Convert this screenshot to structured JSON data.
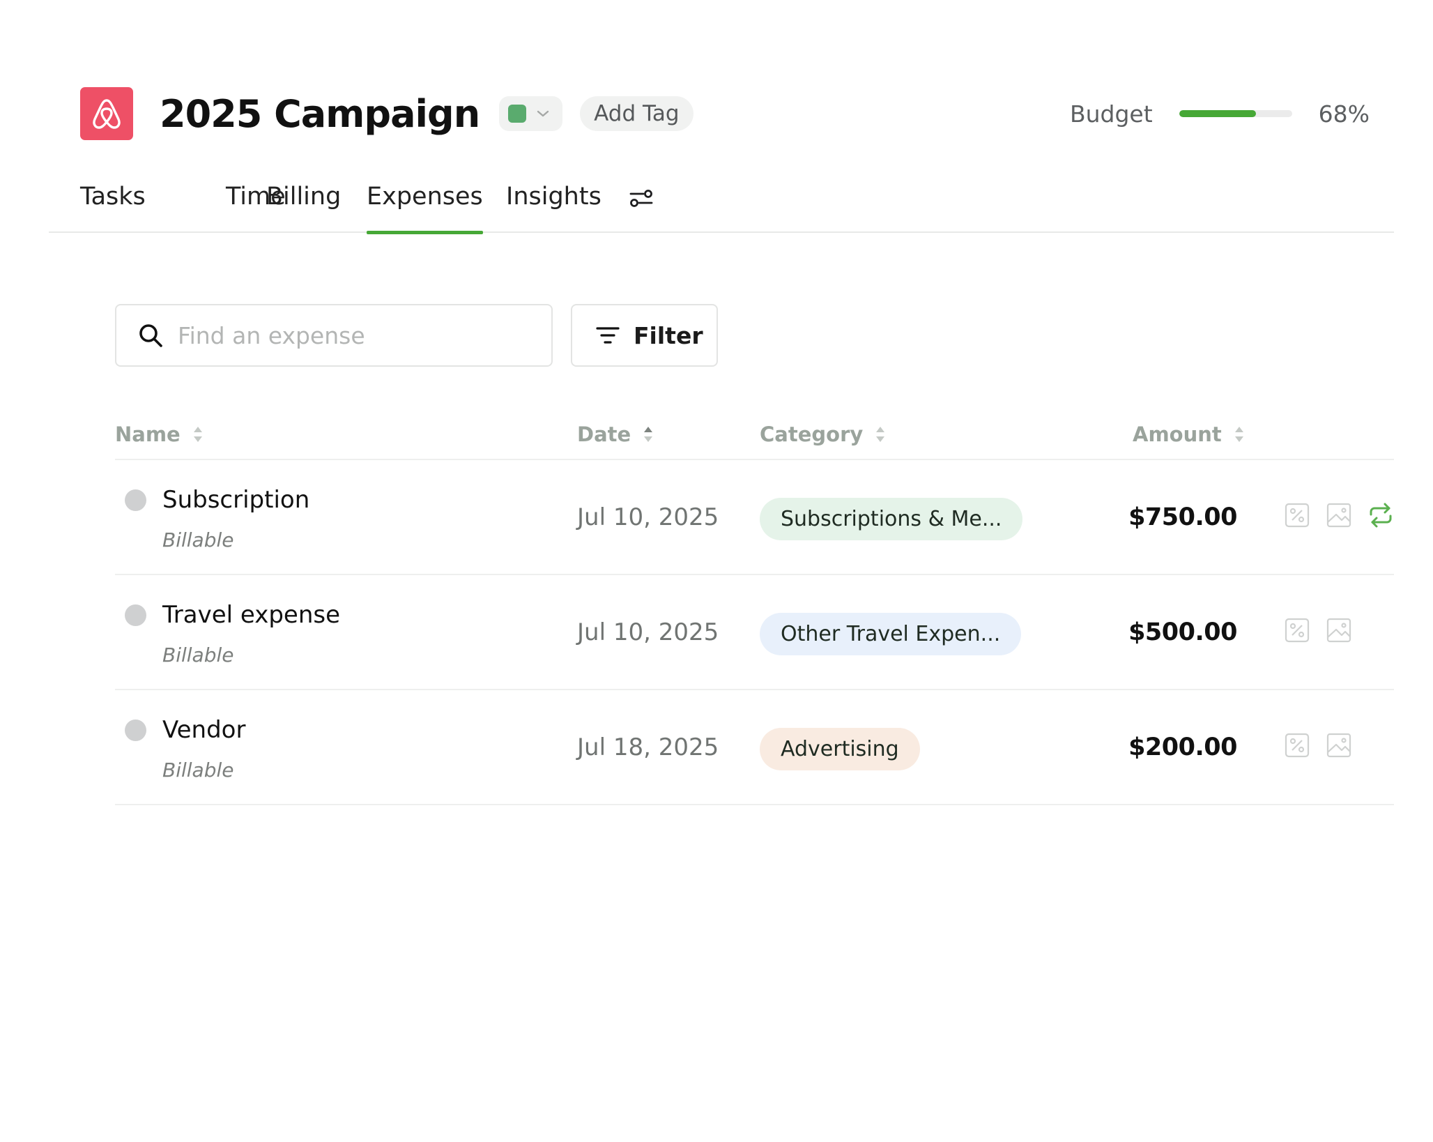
{
  "project": {
    "title": "2025 Campaign",
    "color_swatch": "#5aab6e",
    "add_tag_label": "Add Tag",
    "brand_color": "#ee5066"
  },
  "budget": {
    "label": "Budget",
    "percent_text": "68%",
    "progress": 0.68,
    "bar_color": "#46a836"
  },
  "tabs": [
    {
      "label": "Tasks",
      "active": false
    },
    {
      "label": "Time",
      "active": false
    },
    {
      "label": "Billing",
      "active": false
    },
    {
      "label": "Expenses",
      "active": true
    },
    {
      "label": "Insights",
      "active": false
    }
  ],
  "search": {
    "placeholder": "Find an expense",
    "value": ""
  },
  "filter": {
    "label": "Filter"
  },
  "table": {
    "columns": [
      "Name",
      "Date",
      "Category",
      "Amount"
    ],
    "rows": [
      {
        "name": "Subscription",
        "sub": "Billable",
        "date": "Jul 10, 2025",
        "category": "Subscriptions & Me...",
        "category_color": "#e5f3e9",
        "amount": "$750.00",
        "recurring": true
      },
      {
        "name": "Travel expense",
        "sub": "Billable",
        "date": "Jul 10, 2025",
        "category": "Other Travel Expen...",
        "category_color": "#e8f0fb",
        "amount": "$500.00",
        "recurring": false
      },
      {
        "name": "Vendor",
        "sub": "Billable",
        "date": "Jul 18, 2025",
        "category": "Advertising",
        "category_color": "#f9ebe1",
        "amount": "$200.00",
        "recurring": false
      }
    ]
  },
  "icons": {
    "logo": "airbnb-logo-icon",
    "dropdown": "chevron-down-icon",
    "tab_settings": "sliders-icon",
    "search": "search-icon",
    "filter": "filter-icon",
    "sort": "sort-icon",
    "tax": "percent-icon",
    "receipt": "image-icon",
    "recurring": "repeat-icon"
  }
}
